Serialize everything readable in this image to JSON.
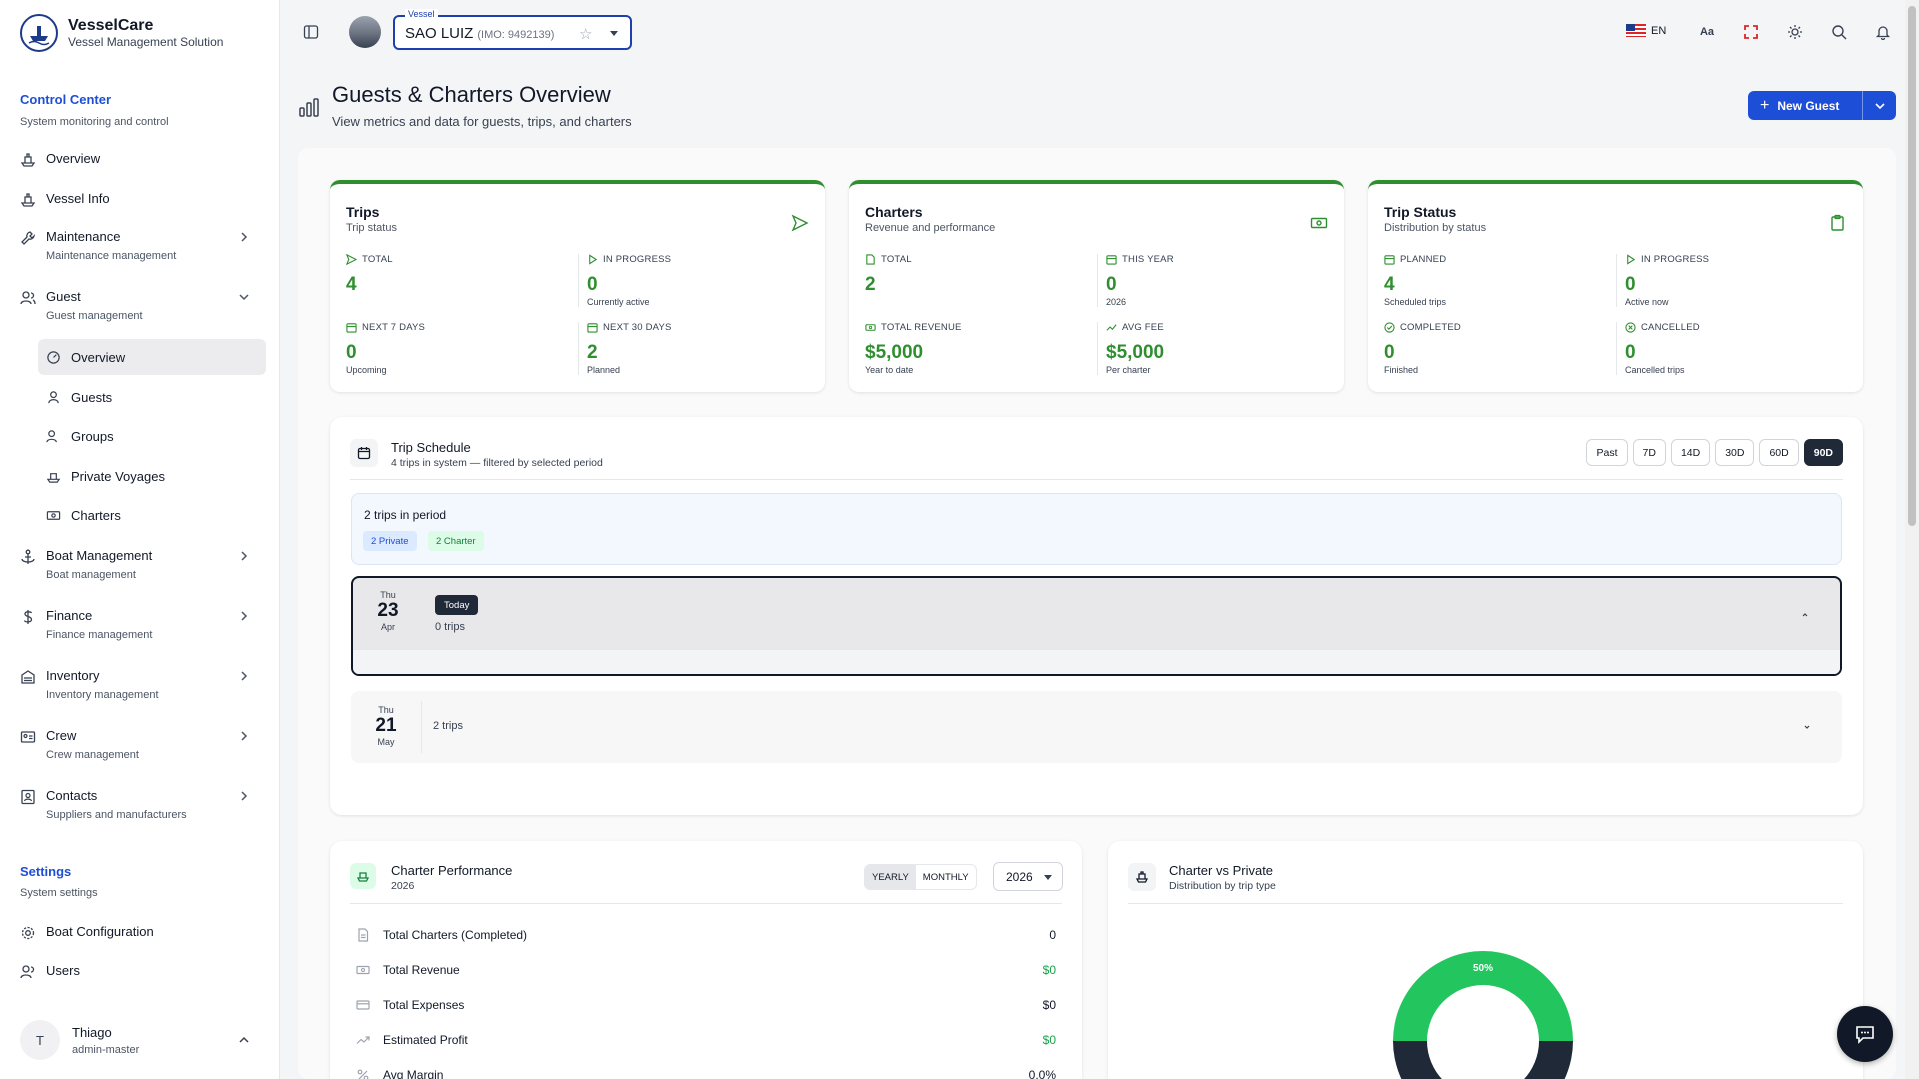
{
  "brand": {
    "name": "VesselCare",
    "tagline": "Vessel Management Solution"
  },
  "sidebar": {
    "control_center": {
      "title": "Control Center",
      "subtitle": "System monitoring and control"
    },
    "items": [
      {
        "label": "Overview",
        "icon": "ship-icon"
      },
      {
        "label": "Vessel Info",
        "icon": "ship-icon"
      },
      {
        "label": "Maintenance",
        "sub": "Maintenance management",
        "icon": "wrench-icon"
      },
      {
        "label": "Guest",
        "sub": "Guest management",
        "icon": "users-icon"
      },
      {
        "label": "Boat Management",
        "sub": "Boat management",
        "icon": "anchor-icon"
      },
      {
        "label": "Finance",
        "sub": "Finance management",
        "icon": "dollar-icon"
      },
      {
        "label": "Inventory",
        "sub": "Inventory management",
        "icon": "inventory-icon"
      },
      {
        "label": "Crew",
        "sub": "Crew management",
        "icon": "id-card-icon"
      },
      {
        "label": "Contacts",
        "sub": "Suppliers and manufacturers",
        "icon": "contacts-icon"
      }
    ],
    "guest_sub": [
      {
        "label": "Overview",
        "icon": "gauge-icon"
      },
      {
        "label": "Guests",
        "icon": "user-icon"
      },
      {
        "label": "Groups",
        "icon": "users-icon"
      },
      {
        "label": "Private Voyages",
        "icon": "ship-icon"
      },
      {
        "label": "Charters",
        "icon": "banknote-icon"
      }
    ],
    "settings": {
      "title": "Settings",
      "subtitle": "System settings"
    },
    "settings_items": [
      {
        "label": "Boat Configuration",
        "icon": "gear-icon"
      },
      {
        "label": "Users",
        "icon": "users-icon"
      }
    ],
    "user": {
      "initial": "T",
      "name": "Thiago",
      "role": "admin-master"
    }
  },
  "topbar": {
    "vessel_legend": "Vessel",
    "vessel_name": "SAO LUIZ",
    "vessel_imo": "(IMO: 9492139)",
    "language": "EN",
    "font_size_label": "Aa"
  },
  "header": {
    "title": "Guests & Charters Overview",
    "subtitle": "View metrics and data for guests, trips, and charters",
    "new_guest": "New Guest"
  },
  "cards": {
    "trips": {
      "title": "Trips",
      "subtitle": "Trip status",
      "metrics": [
        {
          "label": "TOTAL",
          "value": "4",
          "sub": ""
        },
        {
          "label": "IN PROGRESS",
          "value": "0",
          "sub": "Currently active"
        },
        {
          "label": "NEXT 7 DAYS",
          "value": "0",
          "sub": "Upcoming"
        },
        {
          "label": "NEXT 30 DAYS",
          "value": "2",
          "sub": "Planned"
        }
      ]
    },
    "charters": {
      "title": "Charters",
      "subtitle": "Revenue and performance",
      "metrics": [
        {
          "label": "TOTAL",
          "value": "2",
          "sub": ""
        },
        {
          "label": "THIS YEAR",
          "value": "0",
          "sub": "2026"
        },
        {
          "label": "TOTAL REVENUE",
          "value": "$5,000",
          "sub": "Year to date"
        },
        {
          "label": "AVG FEE",
          "value": "$5,000",
          "sub": "Per charter"
        }
      ]
    },
    "trip_status": {
      "title": "Trip Status",
      "subtitle": "Distribution by status",
      "metrics": [
        {
          "label": "PLANNED",
          "value": "4",
          "sub": "Scheduled trips"
        },
        {
          "label": "IN PROGRESS",
          "value": "0",
          "sub": "Active now"
        },
        {
          "label": "COMPLETED",
          "value": "0",
          "sub": "Finished"
        },
        {
          "label": "CANCELLED",
          "value": "0",
          "sub": "Cancelled trips"
        }
      ]
    }
  },
  "schedule": {
    "title": "Trip Schedule",
    "subtitle": "4 trips in system — filtered by selected period",
    "periods": [
      "Past",
      "7D",
      "14D",
      "30D",
      "60D",
      "90D"
    ],
    "active_period": "90D",
    "period_summary": "2 trips in period",
    "chips": {
      "private": "2 Private",
      "charter": "2 Charter"
    },
    "days": [
      {
        "weekday": "Thu",
        "day": "23",
        "month": "Apr",
        "badge": "Today",
        "trips": "0 trips"
      },
      {
        "weekday": "Thu",
        "day": "21",
        "month": "May",
        "trips": "2 trips"
      }
    ]
  },
  "performance": {
    "title": "Charter Performance",
    "year_sub": "2026",
    "toggle": [
      "YEARLY",
      "MONTHLY"
    ],
    "year": "2026",
    "rows": [
      {
        "label": "Total Charters (Completed)",
        "value": "0",
        "green": false
      },
      {
        "label": "Total Revenue",
        "value": "$0",
        "green": true
      },
      {
        "label": "Total Expenses",
        "value": "$0",
        "green": false
      },
      {
        "label": "Estimated Profit",
        "value": "$0",
        "green": true
      },
      {
        "label": "Avg Margin",
        "value": "0.0%",
        "green": false
      }
    ]
  },
  "charter_vs_private": {
    "title": "Charter vs Private",
    "subtitle": "Distribution by trip type",
    "charter_pct_label": "50%",
    "colors": {
      "charter": "#22c55e",
      "private": "#1f2937"
    }
  }
}
